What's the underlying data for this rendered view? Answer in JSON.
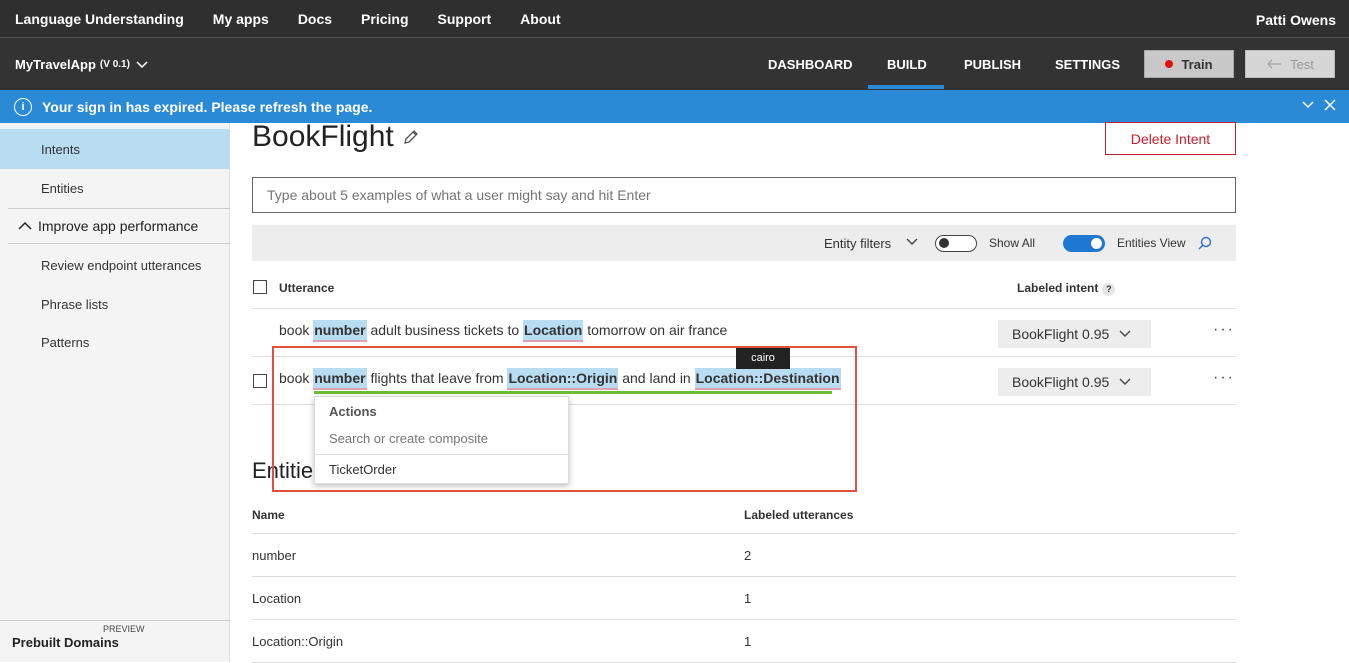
{
  "topnav": {
    "links": [
      "Language Understanding",
      "My apps",
      "Docs",
      "Pricing",
      "Support",
      "About"
    ],
    "user": "Patti Owens"
  },
  "appbar": {
    "app_name": "MyTravelApp",
    "version": "(V 0.1)",
    "tabs": [
      "DASHBOARD",
      "BUILD",
      "PUBLISH",
      "SETTINGS"
    ],
    "active_tab": "BUILD",
    "train_label": "Train",
    "test_label": "Test"
  },
  "banner": {
    "message": "Your sign in has expired. Please refresh the page."
  },
  "sidebar": {
    "items": [
      "Intents",
      "Entities"
    ],
    "group": "Improve app performance",
    "sub_items": [
      "Review endpoint utterances",
      "Phrase lists",
      "Patterns"
    ],
    "prebuilt_preview": "PREVIEW",
    "prebuilt_label": "Prebuilt Domains"
  },
  "main": {
    "title": "BookFlight",
    "delete_label": "Delete Intent",
    "input_placeholder": "Type about 5 examples of what a user might say and hit Enter",
    "filters": {
      "entity_filters": "Entity filters",
      "show_all": "Show All",
      "entities_view": "Entities View"
    },
    "table_headers": {
      "utterance": "Utterance",
      "labeled_intent": "Labeled intent"
    },
    "rows": [
      {
        "parts": [
          "book ",
          "number",
          " adult business tickets to ",
          "Location",
          " tomorrow on air france"
        ],
        "intent": "BookFlight 0.95"
      },
      {
        "parts": [
          "book ",
          "number",
          " flights that leave from ",
          "Location::Origin",
          " and land in ",
          "Location::Destination"
        ],
        "intent": "BookFlight 0.95"
      }
    ],
    "tooltip": "cairo",
    "dropdown": {
      "header": "Actions",
      "search_placeholder": "Search or create composite",
      "item": "TicketOrder"
    },
    "entities_title": "Entitie",
    "entities_headers": {
      "name": "Name",
      "labeled": "Labeled utterances"
    },
    "entities_rows": [
      {
        "name": "number",
        "count": "2"
      },
      {
        "name": "Location",
        "count": "1"
      },
      {
        "name": "Location::Origin",
        "count": "1"
      }
    ]
  },
  "colors": {
    "accent": "#2b8ad6",
    "delete": "#c0202c",
    "entity_bg": "#b8dcf2",
    "highlight_box": "#e0503c",
    "composite_line": "#6ebd3a"
  }
}
